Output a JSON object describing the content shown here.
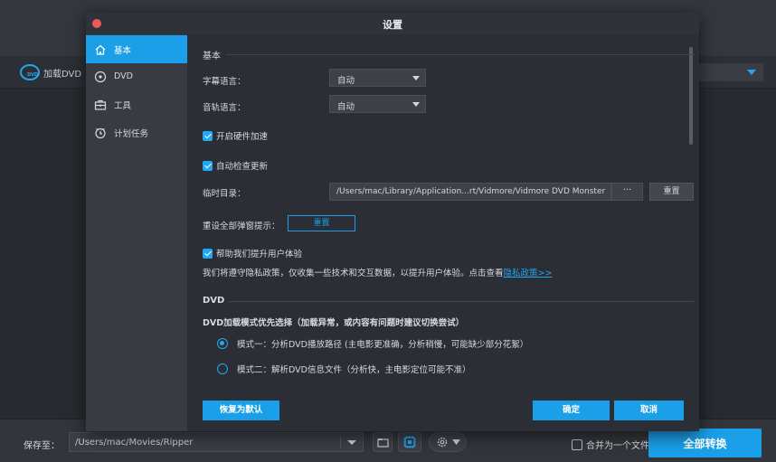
{
  "app": {
    "load_dvd": "加载DVD",
    "save_to_label": "保存至：",
    "save_path": "/Users/mac/Movies/Ripper",
    "merge_label": "合并为一个文件",
    "convert_all": "全部转换"
  },
  "dialog": {
    "title": "设置",
    "sidebar": [
      {
        "label": "基本",
        "icon": "home-icon",
        "active": true
      },
      {
        "label": "DVD",
        "icon": "disc-icon",
        "active": false
      },
      {
        "label": "工具",
        "icon": "toolbox-icon",
        "active": false
      },
      {
        "label": "计划任务",
        "icon": "clock-icon",
        "active": false
      }
    ],
    "basic": {
      "section_title": "基本",
      "subtitle_lang_label": "字幕语言：",
      "subtitle_lang_value": "自动",
      "audio_lang_label": "音轨语言：",
      "audio_lang_value": "自动",
      "hw_accel_label": "开启硬件加速",
      "auto_update_label": "自动检查更新",
      "temp_dir_label": "临时目录：",
      "temp_dir_value": "/Users/mac/Library/Application...rt/Vidmore/Vidmore DVD Monster",
      "temp_dir_dots": "···",
      "temp_dir_reset": "重置",
      "reset_popups_label": "重设全部弹窗提示：",
      "reset_popups_button": "重置",
      "improve_label": "帮助我们提升用户体验",
      "privacy_text": "我们将遵守隐私政策，仅收集一些技术和交互数据，以提升用户体验。点击查看",
      "privacy_link": "隐私政策>>"
    },
    "dvd": {
      "section_title": "DVD",
      "load_mode_label": "DVD加载模式优先选择（加载异常，或内容有问题时建议切换尝试）",
      "mode1": "模式一：分析DVD播放路径 (主电影更准确，分析稍慢，可能缺少部分花絮）",
      "mode2": "模式二：解析DVD信息文件（分析快，主电影定位可能不准）"
    },
    "footer": {
      "restore_default": "恢复为默认",
      "ok": "确定",
      "cancel": "取消"
    }
  },
  "colors": {
    "accent": "#1a9fe8",
    "close_dot": "#ec5b57"
  }
}
